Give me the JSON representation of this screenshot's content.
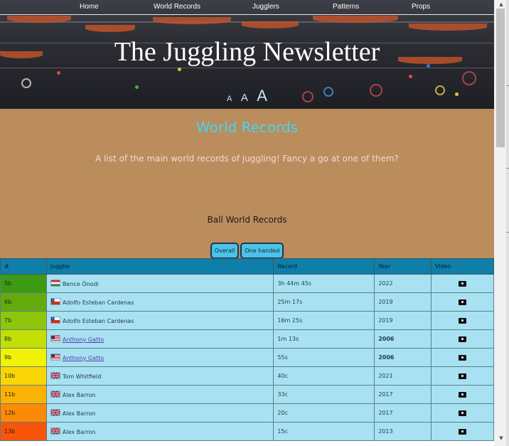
{
  "nav": {
    "items": [
      "Home",
      "World Records",
      "Jugglers",
      "Patterns",
      "Props"
    ]
  },
  "header": {
    "title": "The Juggling Newsletter",
    "font_sizes": [
      "A",
      "A",
      "A"
    ]
  },
  "page": {
    "section_title": "World Records",
    "intro": "A list of the main world records of juggling! Fancy a go at one of them?",
    "table_heading": "Ball World Records",
    "filters": [
      "Overall",
      "One handed"
    ]
  },
  "table": {
    "columns": [
      "#",
      "Juggler",
      "Record",
      "Year",
      "Video"
    ],
    "rows": [
      {
        "grade": "5b",
        "color": "#3d9a12",
        "flag": "hungary",
        "juggler": "Bence Ónodi",
        "linked": false,
        "record": "3h 44m 45s",
        "year": "2022",
        "year_bold": false
      },
      {
        "grade": "6b",
        "color": "#63ab0c",
        "flag": "chile",
        "juggler": "Adolfo Esteban Cardenas",
        "linked": false,
        "record": "25m 17s",
        "year": "2019",
        "year_bold": false
      },
      {
        "grade": "7b",
        "color": "#8fc60b",
        "flag": "chile",
        "juggler": "Adolfo Esteban Cardenas",
        "linked": false,
        "record": "16m 25s",
        "year": "2019",
        "year_bold": false
      },
      {
        "grade": "8b",
        "color": "#c2df07",
        "flag": "usa",
        "juggler": "Anthony Gatto",
        "linked": true,
        "record": "1m 13s",
        "year": "2006",
        "year_bold": true
      },
      {
        "grade": "9b",
        "color": "#f1f205",
        "flag": "usa",
        "juggler": "Anthony Gatto",
        "linked": true,
        "record": "55s",
        "year": "2006",
        "year_bold": true
      },
      {
        "grade": "10b",
        "color": "#fbd606",
        "flag": "uk",
        "juggler": "Tom Whitfield",
        "linked": false,
        "record": "40c",
        "year": "2021",
        "year_bold": false
      },
      {
        "grade": "11b",
        "color": "#fcb204",
        "flag": "uk",
        "juggler": "Alex Barron",
        "linked": false,
        "record": "33c",
        "year": "2017",
        "year_bold": false
      },
      {
        "grade": "12b",
        "color": "#fb8a06",
        "flag": "uk",
        "juggler": "Alex Barron",
        "linked": false,
        "record": "20c",
        "year": "2017",
        "year_bold": false
      },
      {
        "grade": "13b",
        "color": "#f8540a",
        "flag": "uk",
        "juggler": "Alex Barron",
        "linked": false,
        "record": "15c",
        "year": "2013",
        "year_bold": false
      }
    ]
  },
  "colors": {
    "header_bg": "#2c2d33",
    "content_bg": "#bb8c5c",
    "section_title": "#46d5f2",
    "table_header": "#0f7ea8",
    "table_cell": "#a8e2f2",
    "filter_button": "#4cc3e6"
  }
}
